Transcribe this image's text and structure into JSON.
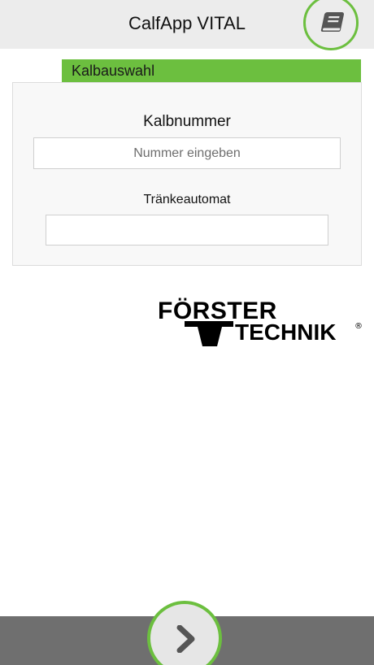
{
  "header": {
    "title": "CalfApp VITAL",
    "manual_icon": "book-icon"
  },
  "section": {
    "title": "Kalbauswahl"
  },
  "form": {
    "calf_number_label": "Kalbnummer",
    "calf_number_placeholder": "Nummer eingeben",
    "calf_number_value": "",
    "feeder_label": "Tränkeautomat",
    "feeder_value": ""
  },
  "logo": {
    "line1": "FÖRSTER",
    "line2": "TECHNIK",
    "mark": "®"
  },
  "footer": {
    "next_icon": "chevron-right-icon"
  },
  "colors": {
    "accent": "#6cbf3f",
    "header_bg": "#ececec",
    "footer_bg": "#6f6f6f"
  }
}
